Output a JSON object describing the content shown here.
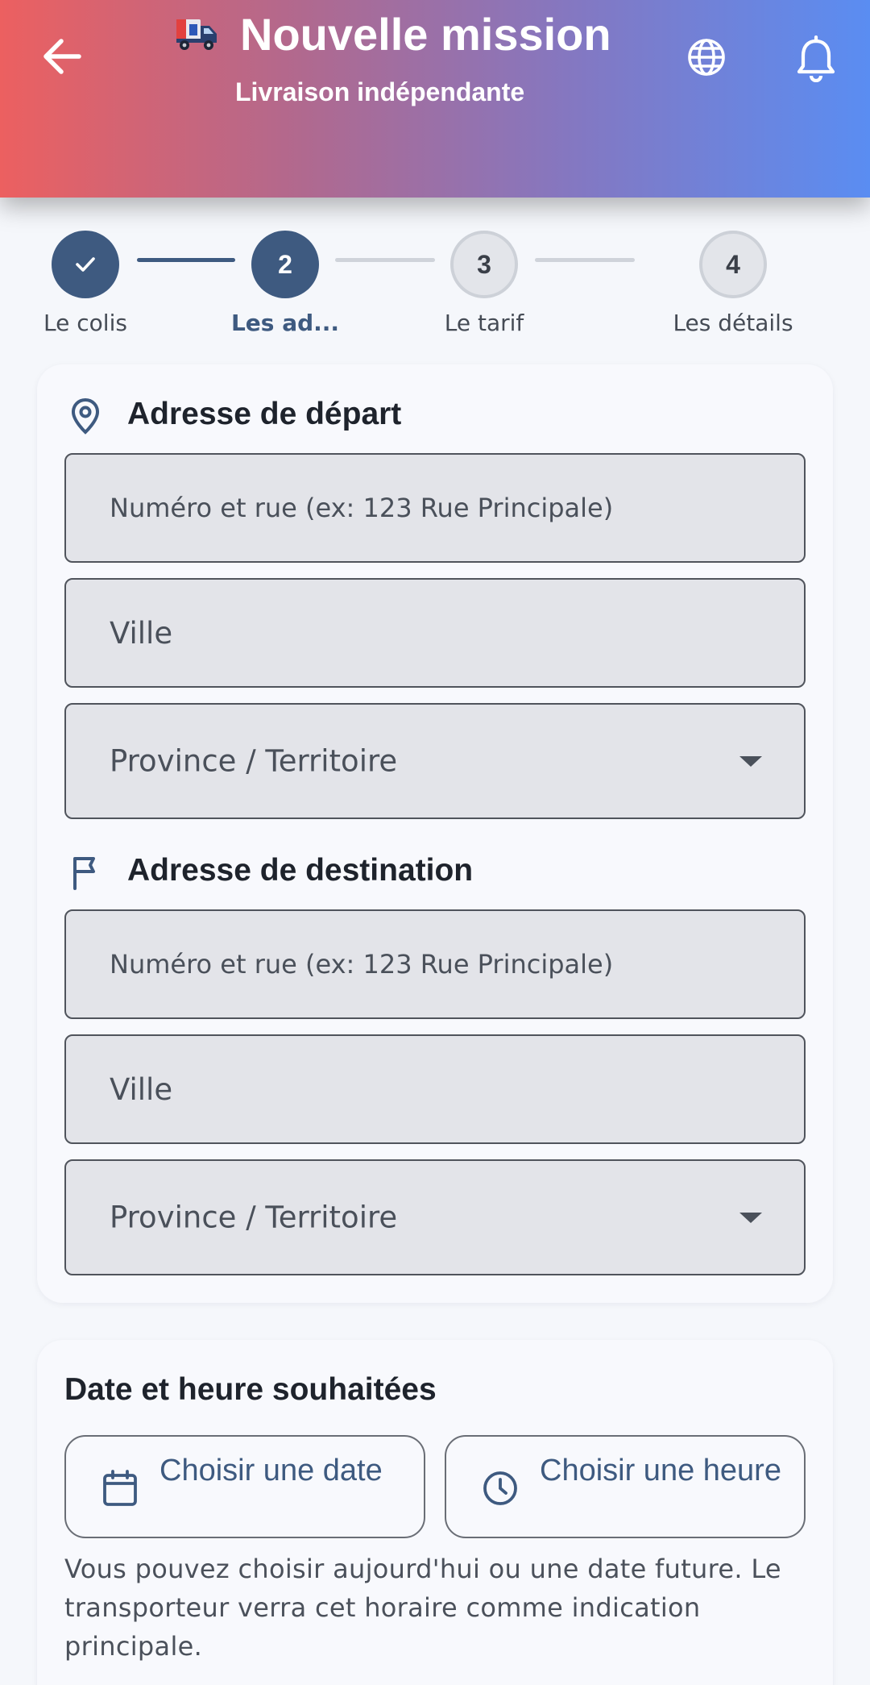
{
  "header": {
    "title": "Nouvelle mission",
    "subtitle": "Livraison indépendante",
    "back_icon": "arrow-left-icon",
    "logo_icon": "delivery-truck-icon",
    "language_icon": "globe-icon",
    "notifications_icon": "bell-icon"
  },
  "stepper": {
    "steps": [
      {
        "number": "1",
        "label": "Le colis",
        "state": "done"
      },
      {
        "number": "2",
        "label": "Les ad...",
        "state": "active"
      },
      {
        "number": "3",
        "label": "Le tarif",
        "state": "todo"
      },
      {
        "number": "4",
        "label": "Les détails",
        "state": "todo"
      }
    ]
  },
  "departure": {
    "title": "Adresse de départ",
    "icon": "map-pin-icon",
    "street_placeholder": "Numéro et rue (ex: 123 Rue Principale)",
    "city_placeholder": "Ville",
    "province_placeholder": "Province / Territoire"
  },
  "destination": {
    "title": "Adresse de destination",
    "icon": "flag-icon",
    "street_placeholder": "Numéro et rue (ex: 123 Rue Principale)",
    "city_placeholder": "Ville",
    "province_placeholder": "Province / Territoire"
  },
  "schedule": {
    "title": "Date et heure souhaitées",
    "date_button": "Choisir une date",
    "time_button": "Choisir une heure",
    "date_icon": "calendar-icon",
    "time_icon": "clock-icon",
    "hint": "Vous pouvez choisir aujourd'hui ou une date future. Le transporteur verra cet horaire comme indication principale."
  },
  "colors": {
    "primary": "#3e5a80",
    "header_gradient_start": "#ec6060",
    "header_gradient_end": "#5a8df2",
    "field_background": "#e3e4e9"
  }
}
